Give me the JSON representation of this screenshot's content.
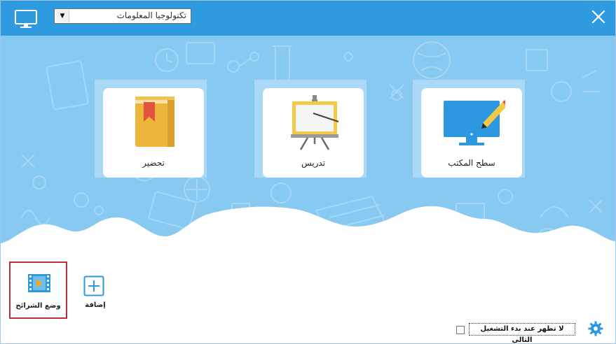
{
  "header": {
    "subject_selected": "تكنولوجيا المعلومات",
    "dropdown_arrow": "▼"
  },
  "modes": [
    {
      "id": "desktop",
      "label": "سطح المكتب",
      "icon": "monitor-pencil-icon"
    },
    {
      "id": "teaching",
      "label": "تدريس",
      "icon": "whiteboard-icon"
    },
    {
      "id": "preparation",
      "label": "تحضير",
      "icon": "book-bookmark-icon"
    }
  ],
  "bottom": {
    "slide_mode_label": "وضع الشرائح",
    "add_label": "إضافة",
    "startup_label": "لا تظهر عند بدء التشغيل التالي"
  },
  "colors": {
    "titlebar": "#2e9be0",
    "sky": "#87c9f1",
    "highlight_border": "#b5303a",
    "accent": "#2e9be0"
  }
}
